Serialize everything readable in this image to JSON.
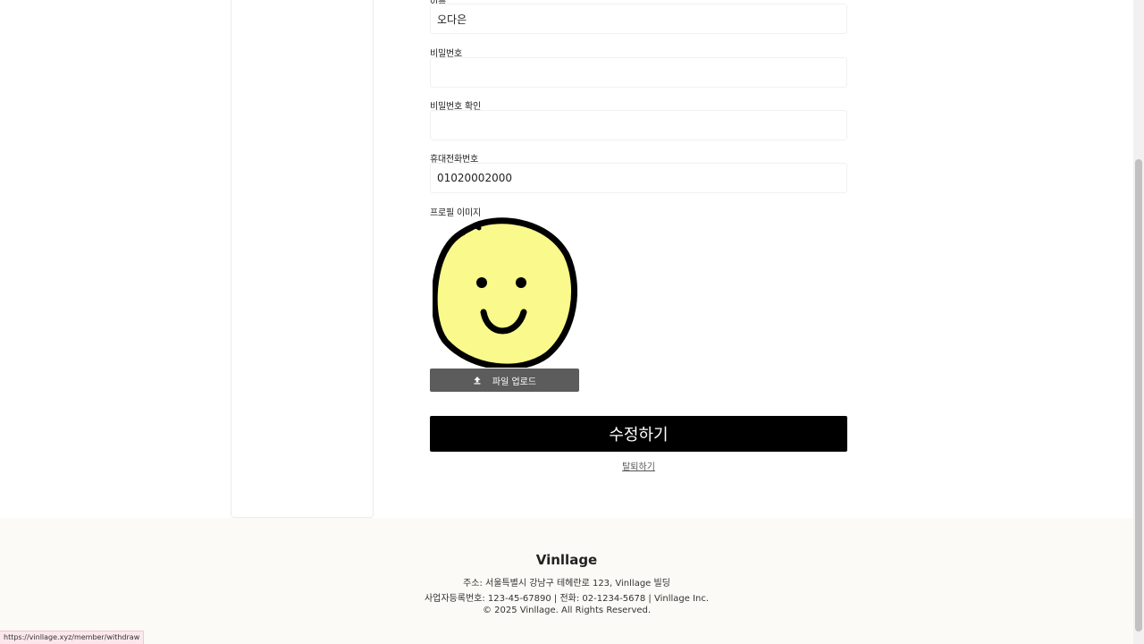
{
  "form": {
    "name_label": "이름",
    "name_value": "오다은",
    "password_label": "비밀번호",
    "password_value": "",
    "password_confirm_label": "비밀번호 확인",
    "password_confirm_value": "",
    "phone_label": "휴대전화번호",
    "phone_value": "01020002000",
    "profile_image_label": "프로필 이미지",
    "upload_label": "파일 업로드",
    "submit_label": "수정하기",
    "withdraw_label": "탈퇴하기"
  },
  "avatar": {
    "face_color": "#f9f98c",
    "outline_color": "#000000"
  },
  "footer": {
    "brand": "Vinllage",
    "address": "주소: 서울특별시 강남구 테헤란로 123, Vinllage 빌딩",
    "business": "사업자등록번호: 123-45-67890 | 전화: 02-1234-5678 | Vinllage Inc.",
    "copyright": "© 2025 Vinllage. All Rights Reserved."
  },
  "status_bar": {
    "url": "https://vinllage.xyz/member/withdraw"
  }
}
